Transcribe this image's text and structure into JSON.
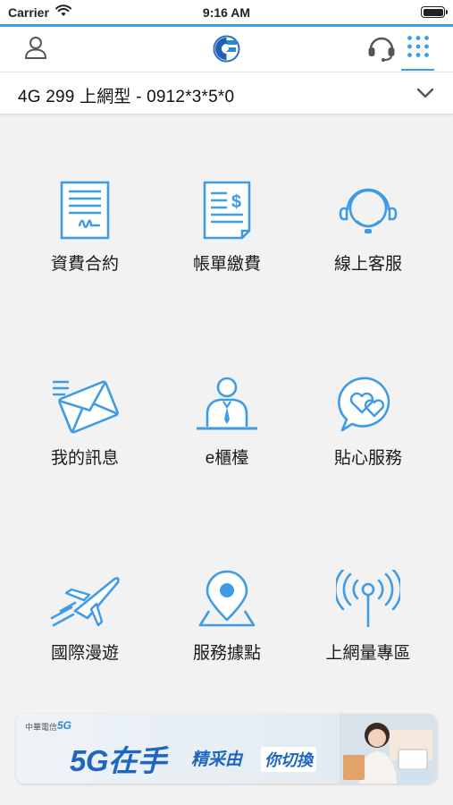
{
  "status_bar": {
    "carrier": "Carrier",
    "time": "9:16 AM"
  },
  "header": {
    "icons": [
      "user-icon",
      "chunghwa-logo",
      "headset-icon",
      "grid-menu-icon"
    ]
  },
  "plan": {
    "label": "4G 299 上網型 - 0912*3*5*0"
  },
  "menu": [
    {
      "label": "資費合約",
      "icon": "contract-icon"
    },
    {
      "label": "帳單繳費",
      "icon": "bill-icon"
    },
    {
      "label": "線上客服",
      "icon": "headset-icon"
    },
    {
      "label": "我的訊息",
      "icon": "mail-icon"
    },
    {
      "label": "e櫃檯",
      "icon": "counter-person-icon"
    },
    {
      "label": "貼心服務",
      "icon": "heart-chat-icon"
    },
    {
      "label": "國際漫遊",
      "icon": "airplane-icon"
    },
    {
      "label": "服務據點",
      "icon": "location-pin-icon"
    },
    {
      "label": "上網量專區",
      "icon": "antenna-icon"
    }
  ],
  "banner": {
    "brand": "中華電信",
    "brand_5g": "5G",
    "headline": "5G在手",
    "sub1": "精采由",
    "sub2": "你切換"
  },
  "colors": {
    "accent": "#3a9ee4",
    "icon": "#3f9be6",
    "background": "#f2f2f2"
  }
}
